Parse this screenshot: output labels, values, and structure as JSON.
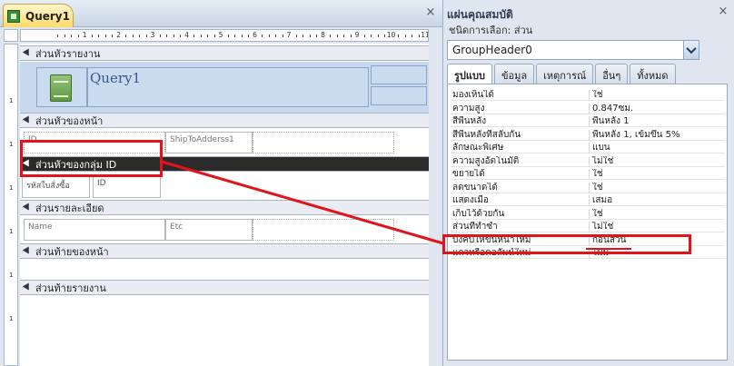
{
  "document_tab": {
    "label": "Query1"
  },
  "close_glyph": "×",
  "ruler": {
    "labels": [
      "1",
      "2",
      "3",
      "4",
      "5",
      "6",
      "7",
      "8",
      "9",
      "10",
      "11",
      "12"
    ]
  },
  "vertical_ruler": {
    "labels": [
      "1",
      "1",
      "1",
      "1",
      "1",
      "1"
    ]
  },
  "sections": {
    "report_header": "ส่วนหัวรายงาน",
    "page_header": "ส่วนหัวของหน้า",
    "group_header": "ส่วนหัวของกลุ่ม ID",
    "detail": "ส่วนรายละเอียด",
    "page_footer": "ส่วนท้ายของหน้า",
    "report_footer": "ส่วนท้ายรายงาน"
  },
  "report_title": "Query1",
  "controls": {
    "page_header_id": "ID",
    "page_header_ship": "ShipToAdderss1",
    "group_label": "รหัสใบสั่งซื้อ",
    "group_id": "ID",
    "detail_name": "Name",
    "detail_etc": "Etc"
  },
  "property_sheet": {
    "title": "แผ่นคุณสมบัติ",
    "selection_type_label": "ชนิดการเลือก:",
    "selection_type_value": "ส่วน",
    "selected_object": "GroupHeader0",
    "tabs": [
      "รูปแบบ",
      "ข้อมูล",
      "เหตุการณ์",
      "อื่นๆ",
      "ทั้งหมด"
    ],
    "active_tab": "รูปแบบ",
    "rows": [
      {
        "name": "มองเห็นได้",
        "value": "ใช่"
      },
      {
        "name": "ความสูง",
        "value": "0.847ซม."
      },
      {
        "name": "สีพื้นหลัง",
        "value": "พื้นหลัง 1"
      },
      {
        "name": "สีพื้นหลังที่สลับกัน",
        "value": "พื้นหลัง 1, เข้มขึ้น 5%"
      },
      {
        "name": "ลักษณะพิเศษ",
        "value": "แบน"
      },
      {
        "name": "ความสูงอัตโนมัติ",
        "value": "ไม่ใช่"
      },
      {
        "name": "ขยายได้",
        "value": "ใช่"
      },
      {
        "name": "ลดขนาดได้",
        "value": "ใช่"
      },
      {
        "name": "แสดงเมื่อ",
        "value": "เสมอ"
      },
      {
        "name": "เก็บไว้ด้วยกัน",
        "value": "ใช่"
      },
      {
        "name": "ส่วนที่ทำซ้ำ",
        "value": "ไม่ใช่"
      },
      {
        "name": "บังคับให้ขึ้นหน้าใหม่",
        "value": "ก่อนส่วน"
      },
      {
        "name": "แถวหรือคอลัมน์ใหม่",
        "value": "ไม่มี"
      }
    ]
  },
  "colors": {
    "annotation_red": "#e0141a",
    "group_bar": "#2b2b2b",
    "header_fill": "#c6d9ee"
  }
}
